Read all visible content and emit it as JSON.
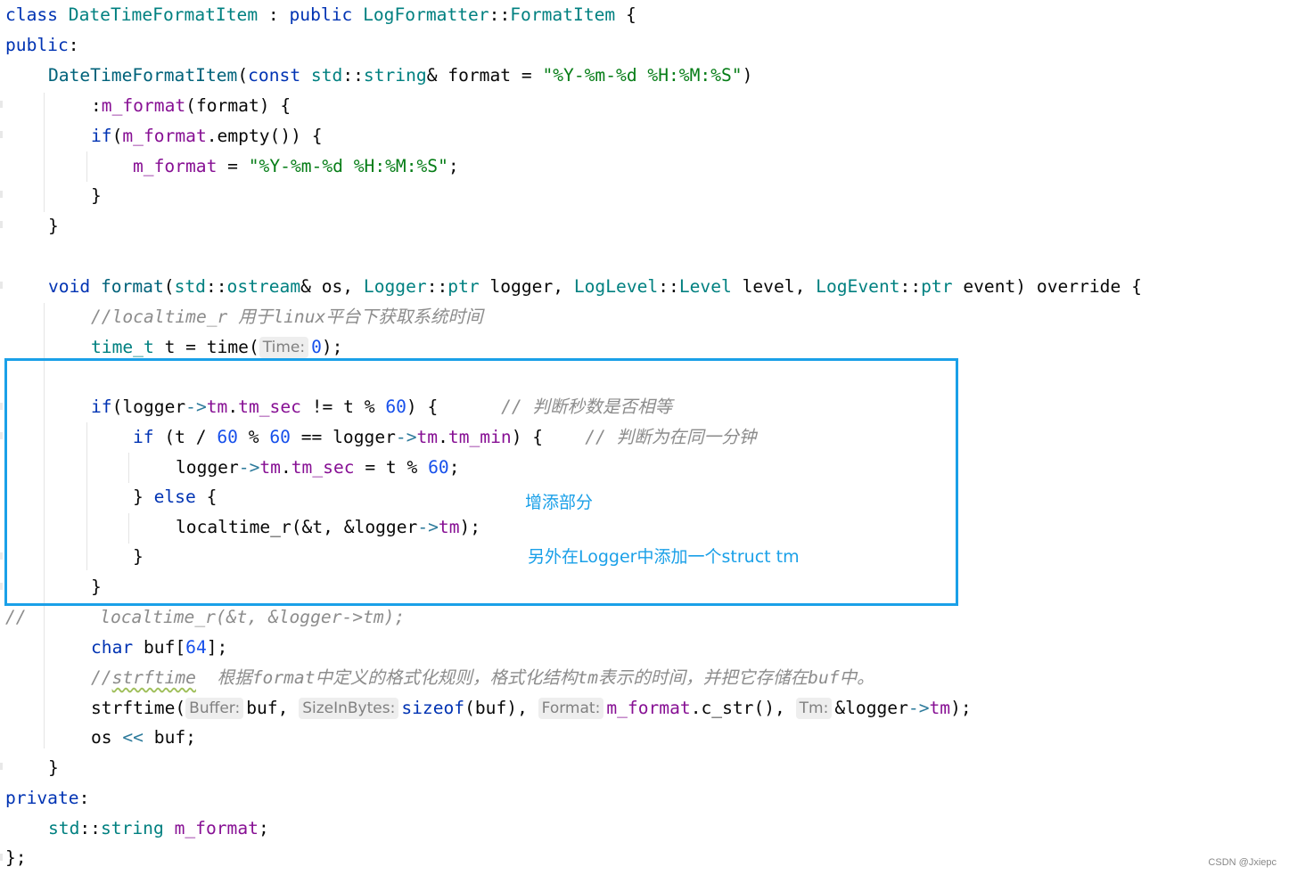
{
  "code": {
    "l01": {
      "a": "class",
      "b": " ",
      "c": "DateTimeFormatItem",
      "d": " : ",
      "e": "public",
      "f": " ",
      "g": "LogFormatter",
      "h": "::",
      "i": "FormatItem",
      "j": " {"
    },
    "l02": {
      "a": "public",
      "b": ":"
    },
    "l03": {
      "a": "DateTimeFormatItem",
      "b": "(",
      "c": "const",
      "d": " ",
      "e": "std",
      "f": "::",
      "g": "string",
      "h": "& format = ",
      "i": "\"%Y-%m-%d %H:%M:%S\"",
      "j": ")"
    },
    "l04": {
      "a": ":",
      "b": "m_format",
      "c": "(format) {"
    },
    "l05": {
      "a": "if",
      "b": "(",
      "c": "m_format",
      "d": ".empty()) {"
    },
    "l06": {
      "a": "m_format",
      "b": " = ",
      "c": "\"%Y-%m-%d %H:%M:%S\"",
      "d": ";"
    },
    "l07": {
      "a": "}"
    },
    "l08": {
      "a": "}"
    },
    "l10": {
      "a": "void",
      "b": " ",
      "c": "format",
      "d": "(",
      "e": "std",
      "f": "::",
      "g": "ostream",
      "h": "& os, ",
      "i": "Logger",
      "j": "::",
      "k": "ptr",
      "l": " logger, ",
      "m": "LogLevel",
      "n": "::",
      "o": "Level",
      "p": " level, ",
      "q": "LogEvent",
      "r": "::",
      "s": "ptr",
      "t": " event) override {"
    },
    "l11": {
      "a": "//localtime_r 用于linux平台下获取系统时间"
    },
    "l12": {
      "a": "time_t",
      "b": " t = time(",
      "hint": "Time:",
      "c": "0",
      "d": ");"
    },
    "l14": {
      "a": "if",
      "b": "(logger",
      "c": "->",
      "d": "tm",
      "e": ".",
      "f": "tm_sec",
      "g": " != t % ",
      "h": "60",
      "i": ") {",
      "j": "      // 判断秒数是否相等"
    },
    "l15": {
      "a": "if",
      "b": " (t / ",
      "c": "60",
      "d": " % ",
      "e": "60",
      "f": " == logger",
      "g": "->",
      "h": "tm",
      "i": ".",
      "j": "tm_min",
      "k": ") {",
      "l": "    // 判断为在同一分钟"
    },
    "l16": {
      "a": "logger",
      "b": "->",
      "c": "tm",
      "d": ".",
      "e": "tm_sec",
      "f": " = t % ",
      "g": "60",
      "h": ";"
    },
    "l17": {
      "a": "} ",
      "b": "else",
      "c": " {"
    },
    "l18": {
      "a": "localtime_r(&t, &logger",
      "b": "->",
      "c": "tm",
      "d": ");"
    },
    "l19": {
      "a": "}"
    },
    "l20": {
      "a": "}"
    },
    "l21": {
      "a": "//       localtime_r(&t, &logger->tm);"
    },
    "l22": {
      "a": "char",
      "b": " buf[",
      "c": "64",
      "d": "];"
    },
    "l23": {
      "a": "//",
      "b": "strftime",
      "c": "  根据format中定义的格式化规则，格式化结构tm表示的时间，并把它存储在buf中。"
    },
    "l24": {
      "a": "strftime(",
      "hint1": "Buffer:",
      "b": "buf, ",
      "hint2": "SizeInBytes:",
      "c": "sizeof",
      "d": "(buf), ",
      "hint3": "Format:",
      "e": "m_format",
      "f": ".c_str(), ",
      "hint4": "Tm:",
      "g": "&logger",
      "h": "->",
      "i": "tm",
      "j": ");"
    },
    "l25": {
      "a": "os ",
      "b": "<<",
      "c": " buf;"
    },
    "l26": {
      "a": "}"
    },
    "l27": {
      "a": "private",
      "b": ":"
    },
    "l28": {
      "a": "std",
      "b": "::",
      "c": "string",
      "d": " ",
      "e": "m_format",
      "f": ";"
    },
    "l29": {
      "a": "};"
    }
  },
  "annotations": {
    "added_part": "增添部分",
    "struct_note": "另外在Logger中添加一个struct tm"
  },
  "watermark": "CSDN @Jxiepc",
  "colors": {
    "highlight_border": "#1aa0e8",
    "annotation_text": "#1aa0e8",
    "keyword": "#0033b3",
    "type": "#008080",
    "field": "#871094",
    "string": "#067d17",
    "number": "#1750eb",
    "comment": "#8c8c8c"
  }
}
